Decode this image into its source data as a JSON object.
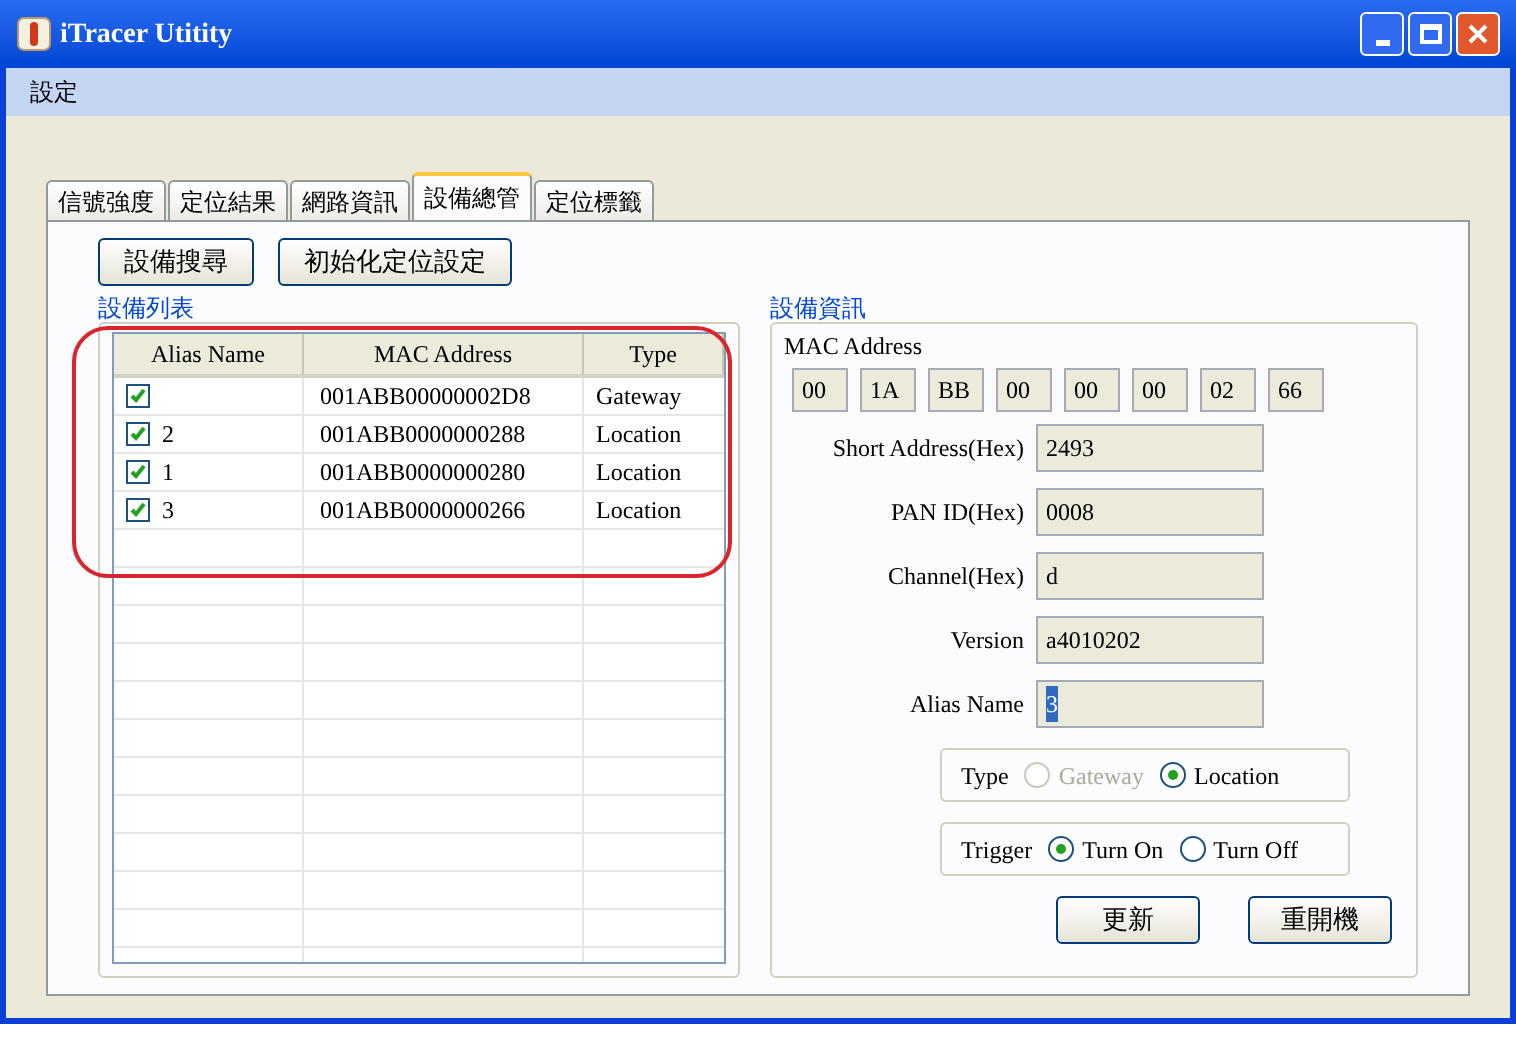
{
  "window": {
    "title": "iTracer Utitity"
  },
  "menu": [
    "設定"
  ],
  "tabs": [
    {
      "label": "信號強度",
      "selected": false
    },
    {
      "label": "定位結果",
      "selected": false
    },
    {
      "label": "網路資訊",
      "selected": false
    },
    {
      "label": "設備總管",
      "selected": true
    },
    {
      "label": "定位標籤",
      "selected": false
    }
  ],
  "toolbar_buttons": [
    "設備搜尋",
    "初始化定位設定"
  ],
  "device_list": {
    "title": "設備列表",
    "columns": [
      "Alias Name",
      "MAC Address",
      "Type"
    ],
    "rows": [
      {
        "checked": true,
        "mac": "001ABB00000002D8",
        "type": "Gateway"
      },
      {
        "checked": true,
        "alias": "2",
        "mac": "001ABB0000000288",
        "type": "Location"
      },
      {
        "checked": true,
        "alias": "1",
        "mac": "001ABB0000000280",
        "type": "Location"
      },
      {
        "checked": true,
        "alias": "3",
        "mac": "001ABB0000000266",
        "type": "Location"
      }
    ]
  },
  "device_info": {
    "title": "設備資訊",
    "mac_label": "MAC Address",
    "mac_bytes": [
      "00",
      "1A",
      "BB",
      "00",
      "00",
      "00",
      "02",
      "66"
    ],
    "fields": [
      {
        "label": "Short Address(Hex)",
        "value": "2493",
        "text_selected": false
      },
      {
        "label": "PAN ID(Hex)",
        "value": "0008",
        "text_selected": false
      },
      {
        "label": "Channel(Hex)",
        "value": "d",
        "text_selected": false
      },
      {
        "label": "Version",
        "value": "a4010202",
        "text_selected": false
      },
      {
        "label": "Alias Name",
        "value": "3",
        "text_selected": true
      }
    ],
    "radio_groups": [
      {
        "label": "Type",
        "options": [
          {
            "label": "Gateway",
            "selected": false,
            "disabled": true
          },
          {
            "label": "Location",
            "selected": true,
            "disabled": false
          }
        ]
      },
      {
        "label": "Trigger",
        "options": [
          {
            "label": "Turn On",
            "selected": true,
            "disabled": false
          },
          {
            "label": "Turn Off",
            "selected": false,
            "disabled": false
          }
        ]
      }
    ],
    "actions": [
      "更新",
      "重開機"
    ]
  }
}
